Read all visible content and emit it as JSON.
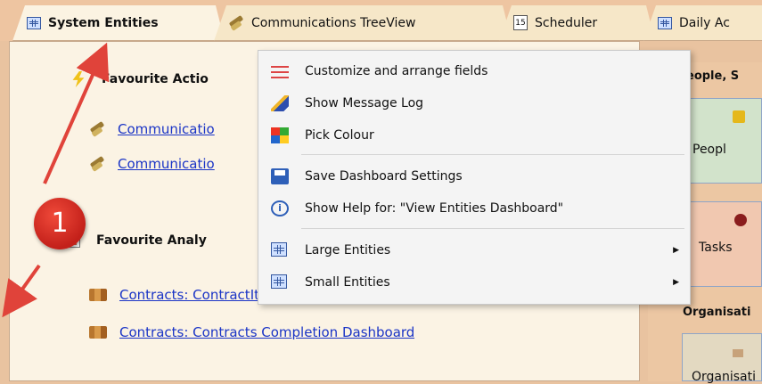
{
  "tabs": [
    {
      "label": "System Entities",
      "icon": "grid-icon",
      "active": true
    },
    {
      "label": "Communications TreeView",
      "icon": "quill-icon",
      "active": false
    },
    {
      "label": "Scheduler",
      "icon": "calendar-icon",
      "calendar_day": "15",
      "active": false
    },
    {
      "label": "Daily Ac",
      "icon": "grid-icon",
      "active": false
    }
  ],
  "main": {
    "favourite_actions": "Favourite Actio",
    "favourite_analy": "Favourite Analy",
    "links": [
      "Communicatio",
      "Communicatio",
      "Contracts: ContractItems Status Board",
      "Contracts: Contracts Completion Dashboard"
    ]
  },
  "right_panel": {
    "people_header": "eople, S",
    "people_label": "Peopl",
    "tasks_label": "Tasks",
    "org_header": "Organisati",
    "org_label": "Organisati"
  },
  "menu": {
    "items": [
      {
        "label": "Customize and arrange fields",
        "icon": "sliders-icon"
      },
      {
        "label": "Show Message Log",
        "icon": "pen-icon"
      },
      {
        "label": "Pick Colour",
        "icon": "palette-icon"
      },
      {
        "label": "Save Dashboard Settings",
        "icon": "save-icon"
      },
      {
        "label": "Show Help for: \"View Entities Dashboard\"",
        "icon": "help-icon",
        "glyph": "i"
      },
      {
        "label": "Large Entities",
        "icon": "grid-icon",
        "submenu": true
      },
      {
        "label": "Small Entities",
        "icon": "grid-icon",
        "submenu": true
      }
    ],
    "submenu_arrow": "▶"
  },
  "annotation": {
    "badge": "1",
    "color": "#d9342b"
  }
}
